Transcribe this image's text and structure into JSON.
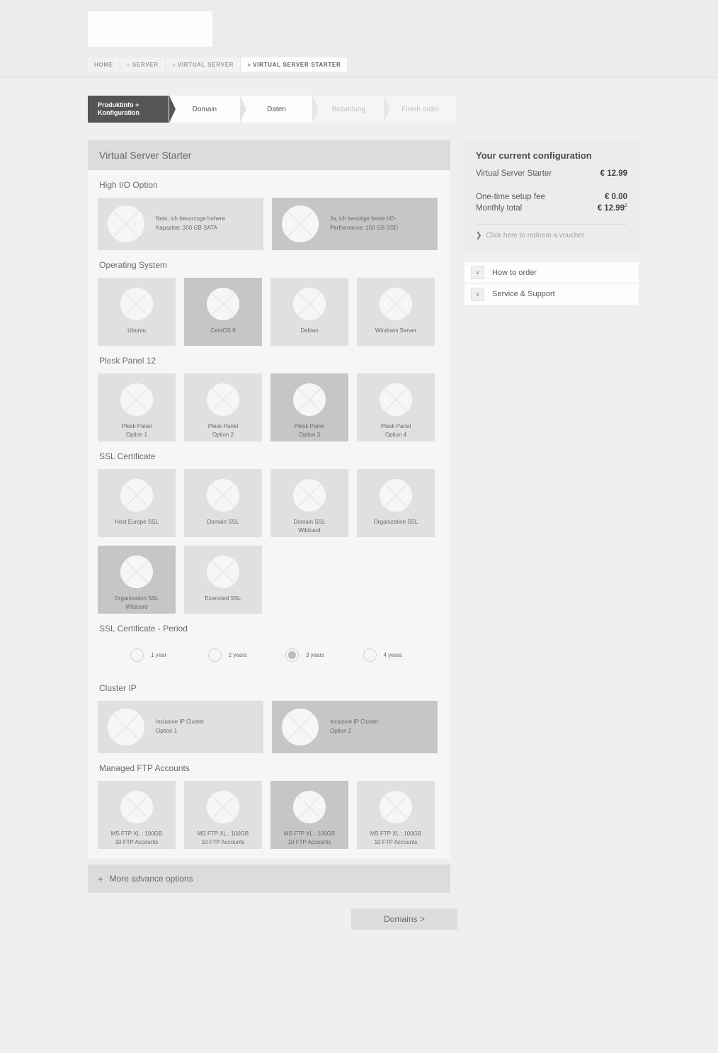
{
  "header": {
    "logo_alt": "logo-placeholder",
    "breadcrumb": [
      {
        "label": "HOME",
        "chevron": "",
        "active": false
      },
      {
        "label": "SERVER",
        "chevron": "»",
        "active": false
      },
      {
        "label": "VIRTUAL SERVER",
        "chevron": "»",
        "active": false
      },
      {
        "label": "VIRTUAL SERVER STARTER",
        "chevron": "»",
        "active": true
      }
    ]
  },
  "stepper": [
    {
      "label": "Produktinfo +\nKonfiguration",
      "state": "current"
    },
    {
      "label": "Domain",
      "state": "done"
    },
    {
      "label": "Daten",
      "state": "done"
    },
    {
      "label": "Bezahlung",
      "state": "muted"
    },
    {
      "label": "Finish order",
      "state": "muted"
    }
  ],
  "main": {
    "title": "Virtual Server Starter",
    "sections": [
      {
        "id": "high-io-option",
        "label": "High I/O Option",
        "layout": "wide",
        "options": [
          {
            "label": "Nein, ich bevorzuge hohere\nKapazitat:  300 GB SATA",
            "selected": false
          },
          {
            "label": "Ja, ich benotige beste I/O-\nPerformance:  150 GB SSD",
            "selected": true
          }
        ]
      },
      {
        "id": "operating-system",
        "label": "Operating System",
        "layout": "tile",
        "options": [
          {
            "label": "Ubuntu",
            "selected": false
          },
          {
            "label": "CentOS 9",
            "selected": true
          },
          {
            "label": "Debian",
            "selected": false
          },
          {
            "label": "Windows Server",
            "selected": false
          }
        ]
      },
      {
        "id": "plesk-panel",
        "label": "Plesk Panel 12",
        "layout": "tile",
        "options": [
          {
            "label": "Plesk Panel\nOption 1",
            "selected": false
          },
          {
            "label": "Plesk Panel\nOption 2",
            "selected": false
          },
          {
            "label": "Plesk Panel\nOption 3",
            "selected": true
          },
          {
            "label": "Plesk Panel\nOption 4",
            "selected": false
          }
        ]
      },
      {
        "id": "ssl-certificate",
        "label": "SSL Certificate",
        "layout": "tile",
        "options": [
          {
            "label": "Host Europe SSL",
            "selected": false
          },
          {
            "label": "Domain SSL",
            "selected": false
          },
          {
            "label": "Domain SSL\nWildcard",
            "selected": false
          },
          {
            "label": "Organization SSL",
            "selected": false
          },
          {
            "label": "Organization SSL\nWildcard",
            "selected": true
          },
          {
            "label": "Extended SSL",
            "selected": false
          }
        ]
      },
      {
        "id": "ssl-certificate-period",
        "label": "SSL Certificate - Period",
        "layout": "radio",
        "options": [
          {
            "label": "1 year",
            "selected": false
          },
          {
            "label": "2 years",
            "selected": false
          },
          {
            "label": "3 years",
            "selected": true
          },
          {
            "label": "4 years",
            "selected": false
          }
        ]
      },
      {
        "id": "cluster-ip",
        "label": "Cluster IP",
        "layout": "wide",
        "options": [
          {
            "label": "Inclusive IP Cluster\nOption 1",
            "selected": false
          },
          {
            "label": "Inclusive IP Cluster\nOption 2",
            "selected": true
          }
        ]
      },
      {
        "id": "managed-ftp-accounts",
        "label": "Managed FTP Accounts",
        "layout": "tile",
        "options": [
          {
            "label": "MS FTP XL : 100GB\n10 FTP Accounts",
            "selected": false
          },
          {
            "label": "MS FTP XL : 100GB\n10 FTP Accounts",
            "selected": false
          },
          {
            "label": "MS FTP XL : 100GB\n10 FTP Accounts",
            "selected": true
          },
          {
            "label": "MS FTP XL : 100GB\n10 FTP Accounts",
            "selected": false
          }
        ]
      }
    ],
    "more_options_label": "More advance options",
    "more_options_plus": "+",
    "next_button_label": "Domains >"
  },
  "sidebar": {
    "config_title": "Your current configuration",
    "product_name": "Virtual Server Starter",
    "product_price": "€ 12.99",
    "setup_fee_label": "One-time setup fee",
    "setup_fee_value": "€ 0.00",
    "monthly_total_label": "Monthly total",
    "monthly_total_value": "€ 12.99",
    "monthly_total_sup": "2",
    "voucher_chevron": "❯",
    "voucher_label": "Click here to redeem a voucher",
    "accordion": [
      {
        "label": "How to order",
        "icon": "chevron-down-icon",
        "glyph": "∨"
      },
      {
        "label": "Service & Support",
        "icon": "chevron-down-icon",
        "glyph": "∨"
      }
    ]
  },
  "colors": {
    "page_bg": "#efefef",
    "panel_bg": "#f6f6f6",
    "tile": "#e0e0e0",
    "tile_selected": "#c6c6c6",
    "header_bar": "#dcdcdc",
    "step_current": "#555558"
  }
}
